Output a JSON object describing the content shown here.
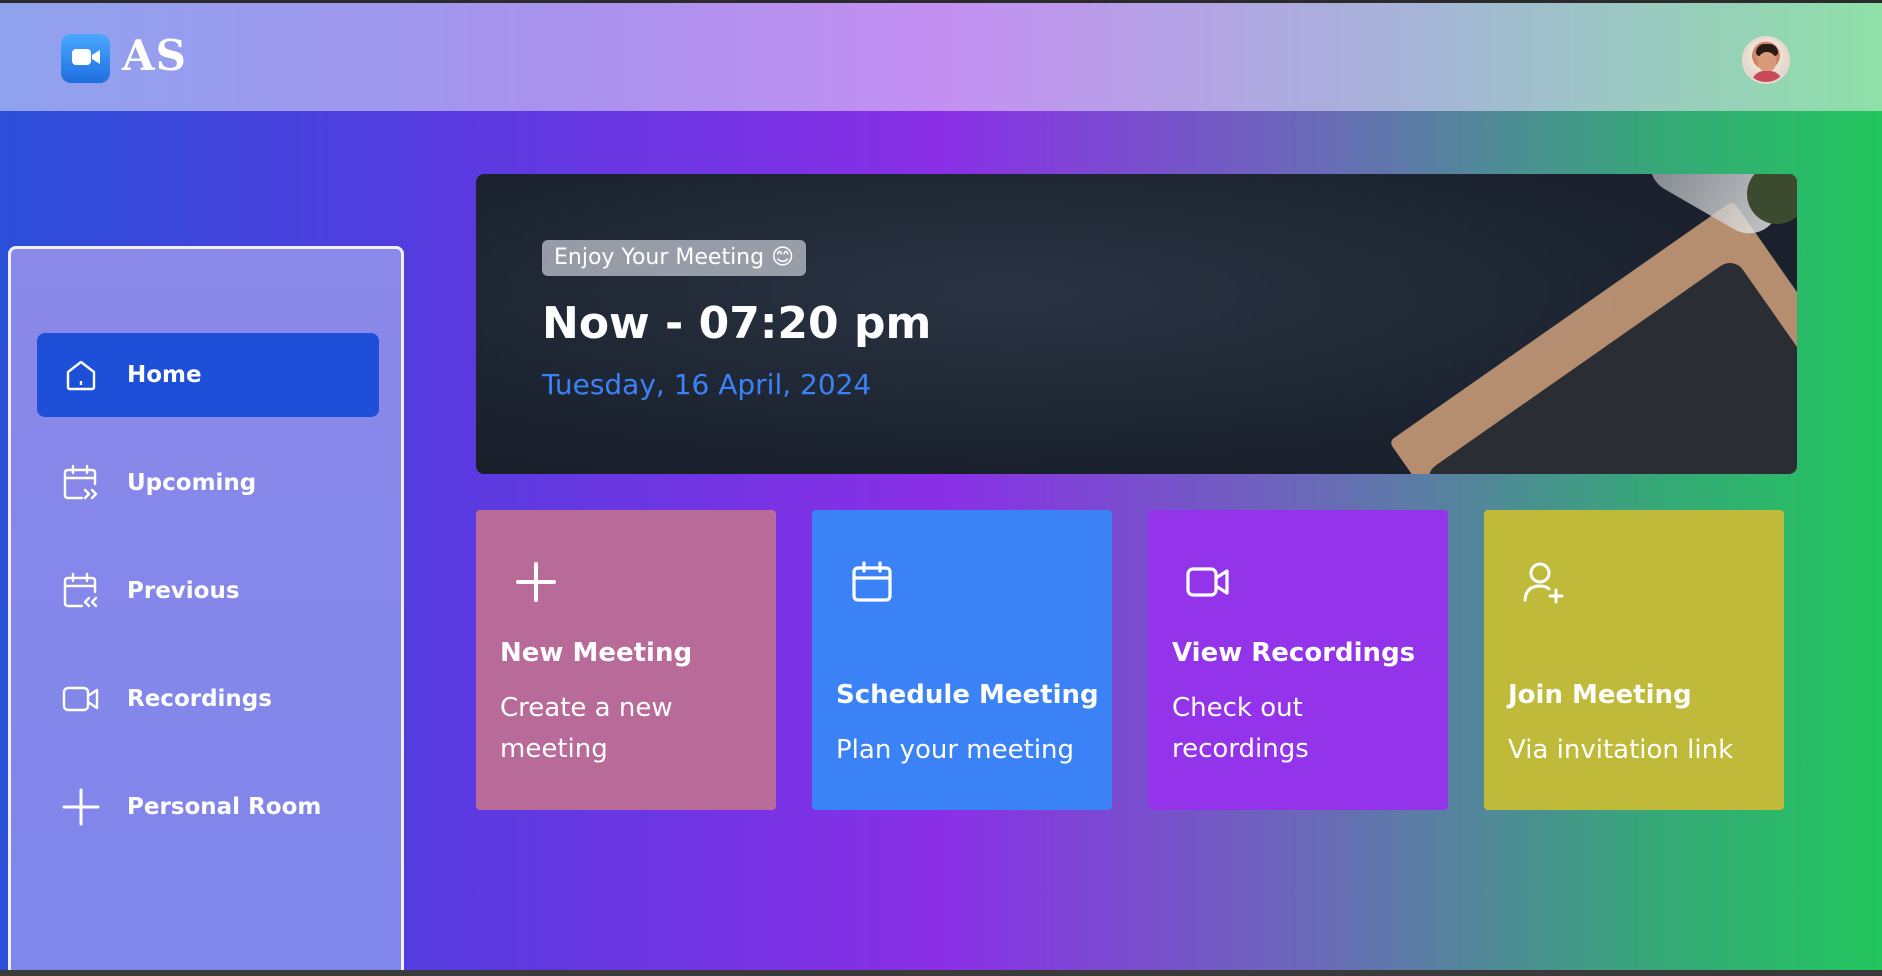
{
  "header": {
    "logo_text": "AS",
    "logo_icon": "video-camera-icon",
    "avatar_icon": "user-avatar"
  },
  "sidebar": {
    "items": [
      {
        "label": "Home",
        "icon": "home-icon",
        "active": true
      },
      {
        "label": "Upcoming",
        "icon": "calendar-upcoming-icon",
        "active": false
      },
      {
        "label": "Previous",
        "icon": "calendar-previous-icon",
        "active": false
      },
      {
        "label": "Recordings",
        "icon": "video-icon",
        "active": false
      },
      {
        "label": "Personal Room",
        "icon": "plus-icon",
        "active": false
      }
    ]
  },
  "hero": {
    "badge": "Enjoy Your Meeting 😊",
    "time": "Now - 07:20 pm",
    "date": "Tuesday, 16 April, 2024"
  },
  "cards": [
    {
      "title": "New Meeting",
      "description": "Create a new meeting",
      "icon": "plus-icon",
      "color": "#b86a98"
    },
    {
      "title": "Schedule Meeting",
      "description": "Plan your meeting",
      "icon": "calendar-icon",
      "color": "#3b82f6"
    },
    {
      "title": "View Recordings",
      "description": "Check out recordings",
      "icon": "video-icon",
      "color": "#9333ea"
    },
    {
      "title": "Join Meeting",
      "description": "Via invitation link",
      "icon": "user-plus-icon",
      "color": "#bfba3a"
    }
  ],
  "colors": {
    "accent": "#1e4fd8",
    "date_text": "#3b82f6"
  }
}
